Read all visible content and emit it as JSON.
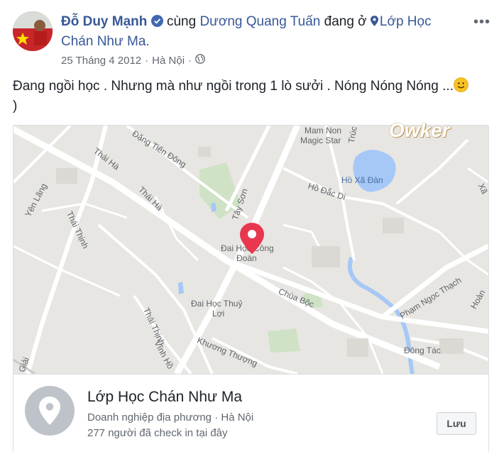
{
  "post": {
    "author": "Đỗ Duy Mạnh",
    "with_text": "cùng",
    "companion": "Dương Quang Tuấn",
    "at_text": "đang ở",
    "place": "Lớp Học Chán Như Ma.",
    "date": "25 Tháng 4 2012",
    "dot": "·",
    "location": "Hà Nội",
    "dot2": "·",
    "more": "•••",
    "text": "Đang ngồi học . Nhưng mà như ngồi trong 1 lò sưởi . Nóng Nóng Nóng ...",
    "text_end": ")"
  },
  "watermark": "Owker",
  "map": {
    "labels": {
      "mam_non": "Mam Non",
      "magic_star": "Magic Star",
      "truc": "Trúc",
      "dang_tien_dong": "Đặng Tiến Đông",
      "thai_ha_1": "Thái Hà",
      "thai_ha_2": "Thái Hà",
      "yen_lang": "Yên Lãng",
      "thai_thinh_1": "Thái Thịnh",
      "thai_thinh_2": "Thái Thịnh",
      "vinh_ho": "Vĩnh Hồ",
      "ho_xa_dan": "Hồ Xã Đàn",
      "ho_dac_di": "Hồ Đắc Di",
      "tay_son": "Tây Sơn",
      "dai_hoc_cong_doan_1": "Đai Học Công",
      "dai_hoc_cong_doan_2": "Đoàn",
      "dai_hoc_thuy_loi_1": "Đai Học Thuỷ",
      "dai_hoc_thuy_loi_2": "Lợi",
      "chua_boc": "Chùa Bộc",
      "khuong_thuong": "Khương Thượng",
      "pham_ngoc_thach": "Phạm Ngọc Thạch",
      "dong_tac": "Đông Tác",
      "hoan": "Hoàn",
      "xa": "Xã",
      "giai": "Giải"
    }
  },
  "card": {
    "title": "Lớp Học Chán Như Ma",
    "category": "Doanh nghiệp địa phương",
    "dot": "·",
    "city": "Hà Nội",
    "checkins": "277 người đã check in tại đây",
    "save_label": "Lưu"
  }
}
